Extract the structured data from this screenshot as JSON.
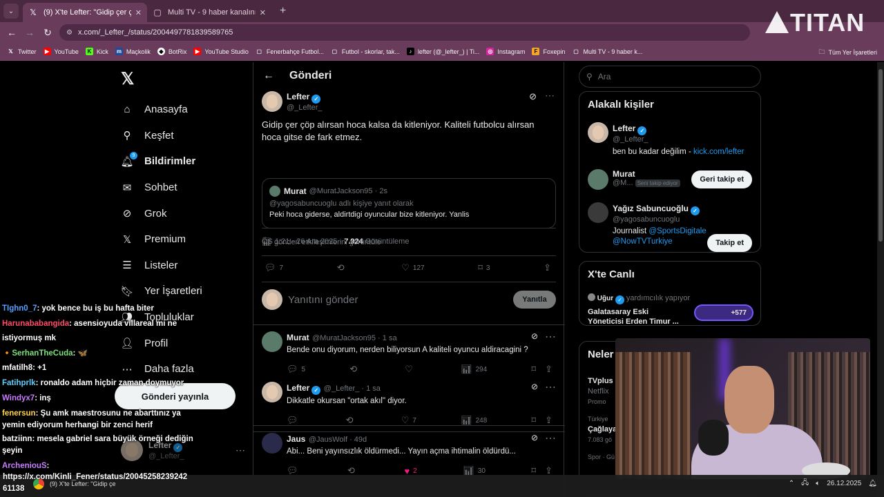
{
  "browser": {
    "tabs": [
      {
        "label": "(9) X'te Lefter: \"Gidip çer çöp alır",
        "icon": "x-logo-icon",
        "active": true
      },
      {
        "label": "Multi TV - 9 haber kanalını aynı",
        "icon": "page-icon",
        "active": false
      }
    ],
    "new_tab": "+",
    "url": "x.com/_Lefter_/status/2004497781839589765",
    "bookmarks": [
      "Twitter",
      "YouTube",
      "Kick",
      "Maçkolik",
      "BotRix",
      "YouTube Studio",
      "Fenerbahçe Futbol...",
      "Futbol - skorlar, tak...",
      "lefter (@_lefter_) | Ti...",
      "Instagram",
      "Foxepin",
      "Multi TV - 9 haber k..."
    ],
    "all_bookmarks": "Tüm Yer İşaretleri"
  },
  "overlay_logo": "TITAN",
  "nav": {
    "items": [
      "Anasayfa",
      "Keşfet",
      "Bildirimler",
      "Sohbet",
      "Grok",
      "Premium",
      "Listeler",
      "Yer İşaretleri",
      "Topluluklar",
      "Profil",
      "Daha fazla"
    ],
    "notif_badge": "9",
    "post_button": "Gönderi yayınla",
    "account_name": "Lefter",
    "account_handle": "@_Lefter_"
  },
  "main": {
    "title": "Gönderi",
    "tweet": {
      "name": "Lefter",
      "handle": "@_Lefter_",
      "text": "Gidip çer çöp alırsan hoca kalsa da kitleniyor. Kaliteli futbolcu alırsan hoca gitse de fark etmez.",
      "quote": {
        "name": "Murat",
        "handle": "@MuratJackson95 · 2s",
        "replying": "@yagosabuncuoglu adlı kişiye yanıt olarak",
        "text": "Peki hoca giderse, aldirtdigi oyuncular bize kitleniyor. Yanlis"
      },
      "time": "ÖS 1:21 · 26 Ara 2025 ·",
      "views": "7.924",
      "views_label": "Görüntüleme",
      "engagements": "gönderi etkileşimlerini görüntüle",
      "replies": "7",
      "likes": "127",
      "bookmarks": "3"
    },
    "reply_placeholder": "Yanıtını gönder",
    "reply_button": "Yanıtla",
    "replies": [
      {
        "name": "Murat",
        "handle": "@MuratJackson95 · 1 sa",
        "text": "Bende onu diyorum, nerden biliyorsun A kaliteli oyuncu aldiracagini ?",
        "reply_count": "5",
        "like_count": "",
        "views": "294"
      },
      {
        "name": "Lefter",
        "handle": "@_Lefter_ · 1 sa",
        "text": "Dikkatle okursan \"ortak akıl\" diyor.",
        "reply_count": "",
        "like_count": "7",
        "views": "248"
      },
      {
        "name": "Jaus",
        "handle": "@JausWolf · 49d",
        "text": "Abi... Beni yayınsızlık öldürmedi... Yayın açma ihtimalin öldürdü...",
        "reply_count": "",
        "like_count": "2",
        "views": "30"
      }
    ]
  },
  "right": {
    "search_placeholder": "Ara",
    "related_title": "Alakalı kişiler",
    "people": [
      {
        "name": "Lefter",
        "handle": "@_Lefter_",
        "bio": "ben bu kadar değilim - ",
        "bio_link": "kick.com/lefter",
        "button": ""
      },
      {
        "name": "Murat",
        "handle": "@M...",
        "follows_you": "Seni takip ediyor",
        "button": "Geri takip et"
      },
      {
        "name": "Yağız Sabuncuoğlu",
        "handle": "@yagosabuncuoglu",
        "bio": "Journalist ",
        "bio_link": "@SportsDigitale",
        "bio_link2": "@NowTVTurkiye",
        "button": "Takip et"
      }
    ],
    "live_title": "X'te Canlı",
    "live": {
      "host": "Uğur",
      "status": "yardımcılık yapıyor",
      "title": "Galatasaray Eski Yöneticisi Erden Timur ...",
      "count": "+577"
    },
    "trends_title": "Neler",
    "trends": [
      "TVplus",
      "Netflix",
      "Promo",
      "Türkiye",
      "Çağlaya",
      "7.083 gö",
      "Spor · Gü"
    ]
  },
  "chat": [
    {
      "user": "TIghn0_7",
      "color": "#5aa0ff",
      "msg": ": yok bence bu iş bu hafta biter"
    },
    {
      "user": "Harunababangida",
      "color": "#ff4a6a",
      "msg": ": asensioyuda villareal mi ne istiyormuş mk"
    },
    {
      "user": "SerhanTheCuda",
      "color": "#7ee07e",
      "msg": ": 🦋"
    },
    {
      "user": "mfatilh8",
      "color": "#ffffff",
      "msg": ": +1"
    },
    {
      "user": "Fatihprlk",
      "color": "#5ed0ff",
      "msg": ": ronaldo adam hiçbir zaman doymuyor"
    },
    {
      "user": "Windyx7",
      "color": "#c77dff",
      "msg": ": inş"
    },
    {
      "user": "fenersun",
      "color": "#ffd54a",
      "msg": ": Şu amk maestrosunu ne abarttınız ya yemin ediyorum herhangi bir zenci herif"
    },
    {
      "user": "batziinn",
      "color": "#ffffff",
      "msg": ": mesela gabriel sara büyük örneği dediğin şeyin"
    },
    {
      "user": "ArcheniouS",
      "color": "#c77dff",
      "msg": ":"
    }
  ],
  "status_url": "https://x.com/Kinli_Fener/status/20045258239242 61138",
  "taskbar": {
    "app": "(9) X'te Lefter: \"Gidip çe",
    "date": "26.12.2025"
  },
  "colors": {
    "accent": "#1d9bf0",
    "frame": "#6a3c5c",
    "like": "#f91880"
  }
}
